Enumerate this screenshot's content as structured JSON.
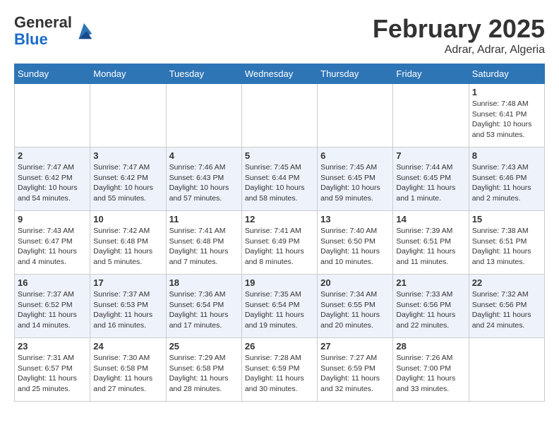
{
  "logo": {
    "general": "General",
    "blue": "Blue"
  },
  "header": {
    "title": "February 2025",
    "subtitle": "Adrar, Adrar, Algeria"
  },
  "weekdays": [
    "Sunday",
    "Monday",
    "Tuesday",
    "Wednesday",
    "Thursday",
    "Friday",
    "Saturday"
  ],
  "weeks": [
    [
      {
        "day": "",
        "info": ""
      },
      {
        "day": "",
        "info": ""
      },
      {
        "day": "",
        "info": ""
      },
      {
        "day": "",
        "info": ""
      },
      {
        "day": "",
        "info": ""
      },
      {
        "day": "",
        "info": ""
      },
      {
        "day": "1",
        "info": "Sunrise: 7:48 AM\nSunset: 6:41 PM\nDaylight: 10 hours\nand 53 minutes."
      }
    ],
    [
      {
        "day": "2",
        "info": "Sunrise: 7:47 AM\nSunset: 6:42 PM\nDaylight: 10 hours\nand 54 minutes."
      },
      {
        "day": "3",
        "info": "Sunrise: 7:47 AM\nSunset: 6:42 PM\nDaylight: 10 hours\nand 55 minutes."
      },
      {
        "day": "4",
        "info": "Sunrise: 7:46 AM\nSunset: 6:43 PM\nDaylight: 10 hours\nand 57 minutes."
      },
      {
        "day": "5",
        "info": "Sunrise: 7:45 AM\nSunset: 6:44 PM\nDaylight: 10 hours\nand 58 minutes."
      },
      {
        "day": "6",
        "info": "Sunrise: 7:45 AM\nSunset: 6:45 PM\nDaylight: 10 hours\nand 59 minutes."
      },
      {
        "day": "7",
        "info": "Sunrise: 7:44 AM\nSunset: 6:45 PM\nDaylight: 11 hours\nand 1 minute."
      },
      {
        "day": "8",
        "info": "Sunrise: 7:43 AM\nSunset: 6:46 PM\nDaylight: 11 hours\nand 2 minutes."
      }
    ],
    [
      {
        "day": "9",
        "info": "Sunrise: 7:43 AM\nSunset: 6:47 PM\nDaylight: 11 hours\nand 4 minutes."
      },
      {
        "day": "10",
        "info": "Sunrise: 7:42 AM\nSunset: 6:48 PM\nDaylight: 11 hours\nand 5 minutes."
      },
      {
        "day": "11",
        "info": "Sunrise: 7:41 AM\nSunset: 6:48 PM\nDaylight: 11 hours\nand 7 minutes."
      },
      {
        "day": "12",
        "info": "Sunrise: 7:41 AM\nSunset: 6:49 PM\nDaylight: 11 hours\nand 8 minutes."
      },
      {
        "day": "13",
        "info": "Sunrise: 7:40 AM\nSunset: 6:50 PM\nDaylight: 11 hours\nand 10 minutes."
      },
      {
        "day": "14",
        "info": "Sunrise: 7:39 AM\nSunset: 6:51 PM\nDaylight: 11 hours\nand 11 minutes."
      },
      {
        "day": "15",
        "info": "Sunrise: 7:38 AM\nSunset: 6:51 PM\nDaylight: 11 hours\nand 13 minutes."
      }
    ],
    [
      {
        "day": "16",
        "info": "Sunrise: 7:37 AM\nSunset: 6:52 PM\nDaylight: 11 hours\nand 14 minutes."
      },
      {
        "day": "17",
        "info": "Sunrise: 7:37 AM\nSunset: 6:53 PM\nDaylight: 11 hours\nand 16 minutes."
      },
      {
        "day": "18",
        "info": "Sunrise: 7:36 AM\nSunset: 6:54 PM\nDaylight: 11 hours\nand 17 minutes."
      },
      {
        "day": "19",
        "info": "Sunrise: 7:35 AM\nSunset: 6:54 PM\nDaylight: 11 hours\nand 19 minutes."
      },
      {
        "day": "20",
        "info": "Sunrise: 7:34 AM\nSunset: 6:55 PM\nDaylight: 11 hours\nand 20 minutes."
      },
      {
        "day": "21",
        "info": "Sunrise: 7:33 AM\nSunset: 6:56 PM\nDaylight: 11 hours\nand 22 minutes."
      },
      {
        "day": "22",
        "info": "Sunrise: 7:32 AM\nSunset: 6:56 PM\nDaylight: 11 hours\nand 24 minutes."
      }
    ],
    [
      {
        "day": "23",
        "info": "Sunrise: 7:31 AM\nSunset: 6:57 PM\nDaylight: 11 hours\nand 25 minutes."
      },
      {
        "day": "24",
        "info": "Sunrise: 7:30 AM\nSunset: 6:58 PM\nDaylight: 11 hours\nand 27 minutes."
      },
      {
        "day": "25",
        "info": "Sunrise: 7:29 AM\nSunset: 6:58 PM\nDaylight: 11 hours\nand 28 minutes."
      },
      {
        "day": "26",
        "info": "Sunrise: 7:28 AM\nSunset: 6:59 PM\nDaylight: 11 hours\nand 30 minutes."
      },
      {
        "day": "27",
        "info": "Sunrise: 7:27 AM\nSunset: 6:59 PM\nDaylight: 11 hours\nand 32 minutes."
      },
      {
        "day": "28",
        "info": "Sunrise: 7:26 AM\nSunset: 7:00 PM\nDaylight: 11 hours\nand 33 minutes."
      },
      {
        "day": "",
        "info": ""
      }
    ]
  ]
}
